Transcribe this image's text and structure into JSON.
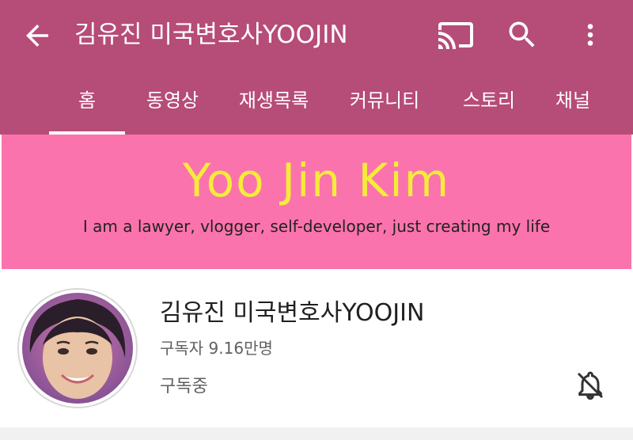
{
  "header": {
    "title": "김유진 미국변호사YOOJIN",
    "icons": [
      "back-arrow-icon",
      "cast-icon",
      "search-icon",
      "more-vert-icon"
    ]
  },
  "tabs": [
    {
      "label": "홈",
      "active": true
    },
    {
      "label": "동영상",
      "active": false
    },
    {
      "label": "재생목록",
      "active": false
    },
    {
      "label": "커뮤니티",
      "active": false
    },
    {
      "label": "스토리",
      "active": false
    },
    {
      "label": "채널",
      "active": false
    }
  ],
  "banner": {
    "title": "Yoo Jin Kim",
    "tagline": "I am a lawyer, vlogger, self-developer, just creating my life"
  },
  "channel": {
    "name": "김유진 미국변호사YOOJIN",
    "subscribers": "구독자 9.16만명",
    "subscribed_label": "구독중",
    "notification_icon": "notifications-off-icon"
  },
  "colors": {
    "appbar": "#b64c78",
    "banner": "#fb73ad",
    "banner_title": "#f5ec3a"
  }
}
